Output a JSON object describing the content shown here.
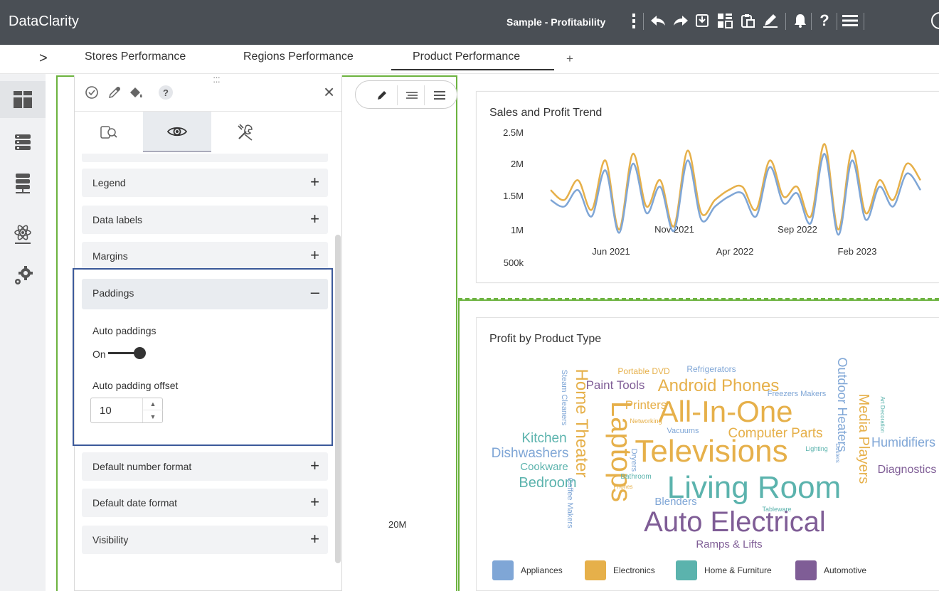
{
  "app": {
    "brand": "DataClarity",
    "document_title": "Sample - Profitability"
  },
  "toolbar_icons": [
    "more-vertical-icon",
    "undo-icon",
    "redo-icon",
    "save-icon",
    "layout-icon",
    "clipboard-icon",
    "edit-pen-icon",
    "notification-bell-icon",
    "help-icon",
    "menu-icon"
  ],
  "tabs": {
    "expand": ">",
    "items": [
      {
        "label": "Stores Performance"
      },
      {
        "label": "Regions Performance"
      },
      {
        "label": "Product Performance",
        "active": true
      }
    ],
    "add": "+"
  },
  "sidebar": [
    "dashboard-icon",
    "data-sources-icon",
    "data-server-icon",
    "science-icon",
    "settings-gears-icon"
  ],
  "panel": {
    "help": "?",
    "close": "×",
    "sections": [
      {
        "label": "Legend",
        "ctrl": "+"
      },
      {
        "label": "Data labels",
        "ctrl": "+"
      },
      {
        "label": "Margins",
        "ctrl": "+"
      },
      {
        "label": "Paddings",
        "ctrl": "–"
      },
      {
        "label": "Default number format",
        "ctrl": "+"
      },
      {
        "label": "Default date format",
        "ctrl": "+"
      },
      {
        "label": "Visibility",
        "ctrl": "+"
      }
    ],
    "paddings": {
      "auto_label": "Auto paddings",
      "toggle_text": "On",
      "toggle_on": true,
      "offset_label": "Auto padding offset",
      "offset_value": "10"
    }
  },
  "canvas": {
    "axis_value": "20M"
  },
  "colors": {
    "appliances": "#7fa6d6",
    "electronics": "#e6b04a",
    "home_furniture": "#5bb3ad",
    "automotive": "#7f5d96",
    "accent_green": "#6cb33f",
    "highlight_blue": "#3c5a9a"
  },
  "chart_data": [
    {
      "type": "line",
      "title": "Sales and Profit Trend",
      "y_ticks": [
        "2.5M",
        "2M",
        "1.5M",
        "1M",
        "500k"
      ],
      "x_ticks_upper": [
        "Nov 2021",
        "Sep 2022"
      ],
      "x_ticks_lower": [
        "Jun 2021",
        "Apr 2022",
        "Feb 2023"
      ],
      "ylim": [
        500000,
        2500000
      ],
      "series": [
        {
          "color": "#e6b04a",
          "values": [
            1600000,
            1450000,
            1750000,
            1300000,
            2050000,
            1000000,
            2150000,
            1350000,
            1750000,
            1050000,
            2200000,
            1250000,
            1450000,
            1600000,
            1650000,
            1300000,
            2050000,
            1500000,
            1650000,
            1200000,
            2300000,
            1000000,
            2200000,
            1250000,
            1750000,
            1450000,
            2000000,
            1750000
          ]
        },
        {
          "color": "#7fa6d6",
          "values": [
            1450000,
            1350000,
            1600000,
            1200000,
            1900000,
            950000,
            2000000,
            1250000,
            1650000,
            980000,
            2050000,
            1150000,
            1350000,
            1500000,
            1550000,
            1200000,
            1950000,
            1400000,
            1550000,
            1100000,
            2150000,
            920000,
            2050000,
            1150000,
            1650000,
            1350000,
            1850000,
            1600000
          ]
        }
      ]
    },
    {
      "type": "wordcloud",
      "title": "Profit by Product Type",
      "legend": [
        {
          "label": "Appliances",
          "color": "#7fa6d6"
        },
        {
          "label": "Electronics",
          "color": "#e6b04a"
        },
        {
          "label": "Home & Furniture",
          "color": "#5bb3ad"
        },
        {
          "label": "Automotive",
          "color": "#7f5d96"
        }
      ],
      "words": [
        {
          "text": "Portable DVD",
          "category": "Electronics"
        },
        {
          "text": "Refrigerators",
          "category": "Appliances"
        },
        {
          "text": "Paint Tools",
          "category": "Automotive"
        },
        {
          "text": "Android Phones",
          "category": "Electronics"
        },
        {
          "text": "Steam Cleaners",
          "category": "Appliances"
        },
        {
          "text": "Home Theater",
          "category": "Electronics"
        },
        {
          "text": "Laptops",
          "category": "Electronics"
        },
        {
          "text": "Printers",
          "category": "Electronics"
        },
        {
          "text": "All-In-One",
          "category": "Electronics"
        },
        {
          "text": "Freezers Makers",
          "category": "Appliances"
        },
        {
          "text": "Outdoor Heaters",
          "category": "Appliances"
        },
        {
          "text": "Media Players",
          "category": "Electronics"
        },
        {
          "text": "Vacuums",
          "category": "Appliances"
        },
        {
          "text": "Computer Parts",
          "category": "Electronics"
        },
        {
          "text": "Kitchen",
          "category": "Home & Furniture"
        },
        {
          "text": "Dishwashers",
          "category": "Appliances"
        },
        {
          "text": "Televisions",
          "category": "Electronics"
        },
        {
          "text": "Humidifiers",
          "category": "Appliances"
        },
        {
          "text": "Cookware",
          "category": "Home & Furniture"
        },
        {
          "text": "Diagnostics",
          "category": "Automotive"
        },
        {
          "text": "Bedroom",
          "category": "Home & Furniture"
        },
        {
          "text": "Living Room",
          "category": "Home & Furniture"
        },
        {
          "text": "Blenders",
          "category": "Appliances"
        },
        {
          "text": "Auto Electrical",
          "category": "Automotive"
        },
        {
          "text": "Ramps & Lifts",
          "category": "Automotive"
        },
        {
          "text": "Coffee Makers",
          "category": "Appliances"
        },
        {
          "text": "Dryers",
          "category": "Appliances"
        },
        {
          "text": "Bathroom",
          "category": "Home & Furniture"
        },
        {
          "text": "Networking",
          "category": "Electronics"
        },
        {
          "text": "Lighting",
          "category": "Home & Furniture"
        },
        {
          "text": "Tableware",
          "category": "Home & Furniture"
        },
        {
          "text": "Phones",
          "category": "Electronics"
        },
        {
          "text": "Dusters",
          "category": "Appliances"
        },
        {
          "text": "Art Decoration",
          "category": "Home & Furniture"
        }
      ]
    }
  ]
}
